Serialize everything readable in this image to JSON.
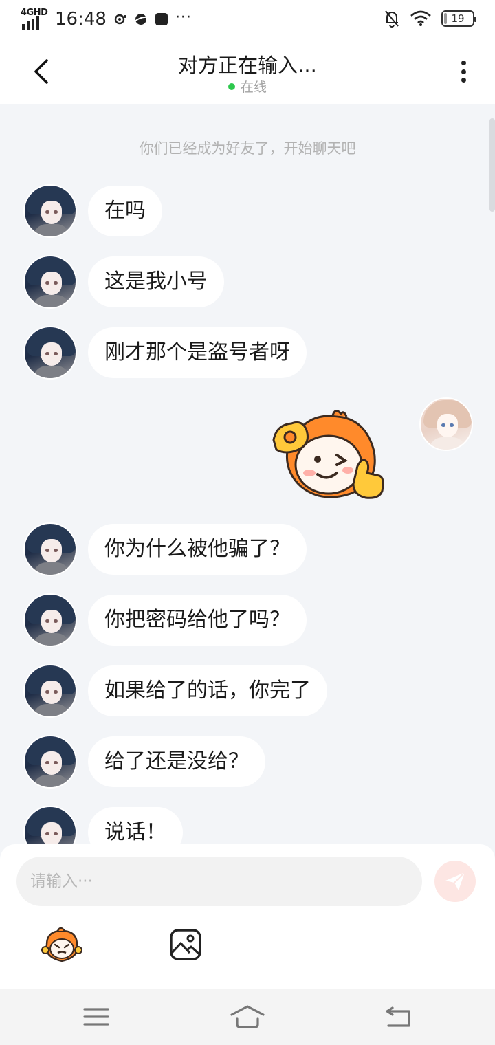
{
  "status_bar": {
    "network": "4GHD",
    "time": "16:48",
    "more": "···",
    "battery": "19",
    "icons": [
      "signal-icon",
      "app-notification-icon",
      "planet-icon",
      "app-square-icon",
      "bell-off-icon",
      "wifi-icon",
      "battery-icon"
    ]
  },
  "header": {
    "title": "对方正在输入...",
    "status": "在线",
    "status_color": "#2dc84d"
  },
  "chat": {
    "system_message": "你们已经成为好友了，开始聊天吧",
    "messages": [
      {
        "side": "left",
        "text": "在吗"
      },
      {
        "side": "left",
        "text": "这是我小号"
      },
      {
        "side": "left",
        "text": "刚才那个是盗号者呀"
      },
      {
        "side": "right",
        "sticker": "ok-thumbs-up-mascot-sticker"
      },
      {
        "side": "left",
        "text": "你为什么被他骗了？"
      },
      {
        "side": "left",
        "text": "你把密码给他了吗？"
      },
      {
        "side": "left",
        "text": "如果给了的话，你完了"
      },
      {
        "side": "left",
        "text": "给了还是没给？"
      },
      {
        "side": "left",
        "text": "说话！"
      }
    ]
  },
  "input": {
    "placeholder": "请输入···",
    "value": "",
    "send_color": "#fde6e3"
  },
  "toolbar": {
    "icons": [
      "emoji-mascot-icon",
      "image-icon"
    ]
  },
  "navbar": {
    "icons": [
      "menu-icon",
      "home-icon",
      "back-icon"
    ]
  }
}
